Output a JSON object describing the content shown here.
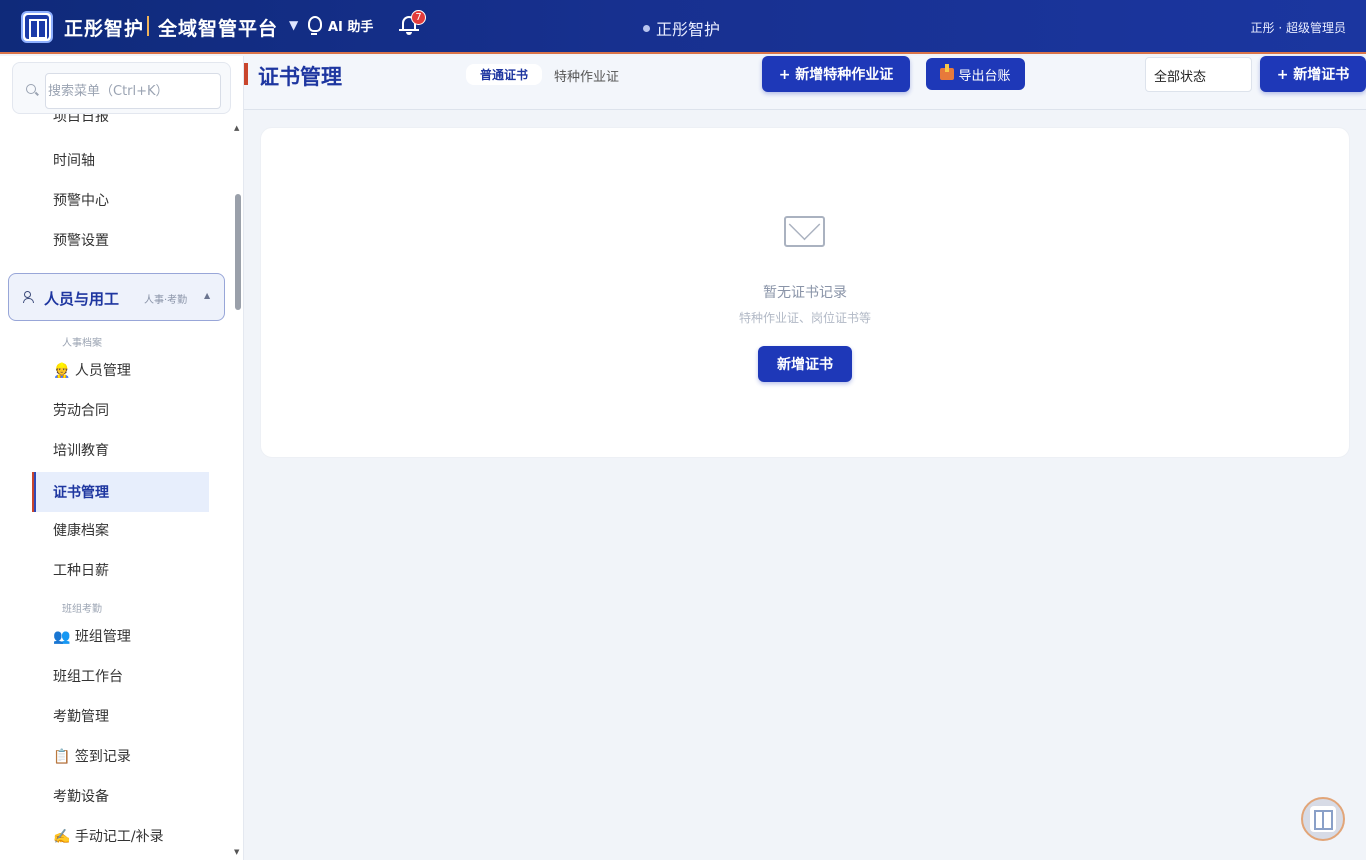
{
  "header": {
    "brand": "正彤智护",
    "platform": "全域智管平台",
    "caret": "▼",
    "ai_label": "AI 助手",
    "notification_count": "7",
    "center_title": "正彤智护",
    "user": "正彤 · 超级管理员"
  },
  "sidebar": {
    "search_placeholder": "搜索菜单（Ctrl+K）",
    "cut_item": "项目日报",
    "items_top": [
      "时间轴",
      "预警中心",
      "预警设置"
    ],
    "section": {
      "label": "人员与用工",
      "sub": "人事·考勤",
      "arrow": "▲"
    },
    "group1": "人事档案",
    "group1_items": [
      "👷 人员管理",
      "劳动合同",
      "培训教育",
      "证书管理",
      "健康档案",
      "工种日薪"
    ],
    "group2": "班组考勤",
    "group2_items": [
      "👥 班组管理",
      "班组工作台",
      "考勤管理",
      "📋 签到记录",
      "考勤设备",
      "✍️ 手动记工/补录"
    ],
    "active": "证书管理"
  },
  "main": {
    "title": "证书管理",
    "tabs": [
      "普通证书",
      "特种作业证"
    ],
    "add_special_btn": "+ 新增特种作业证",
    "export_btn": "导出台账",
    "status_select": "全部状态",
    "add_cert_btn": "+ 新增证书",
    "empty_title": "暂无证书记录",
    "empty_sub": "特种作业证、岗位证书等",
    "empty_btn": "新增证书"
  }
}
